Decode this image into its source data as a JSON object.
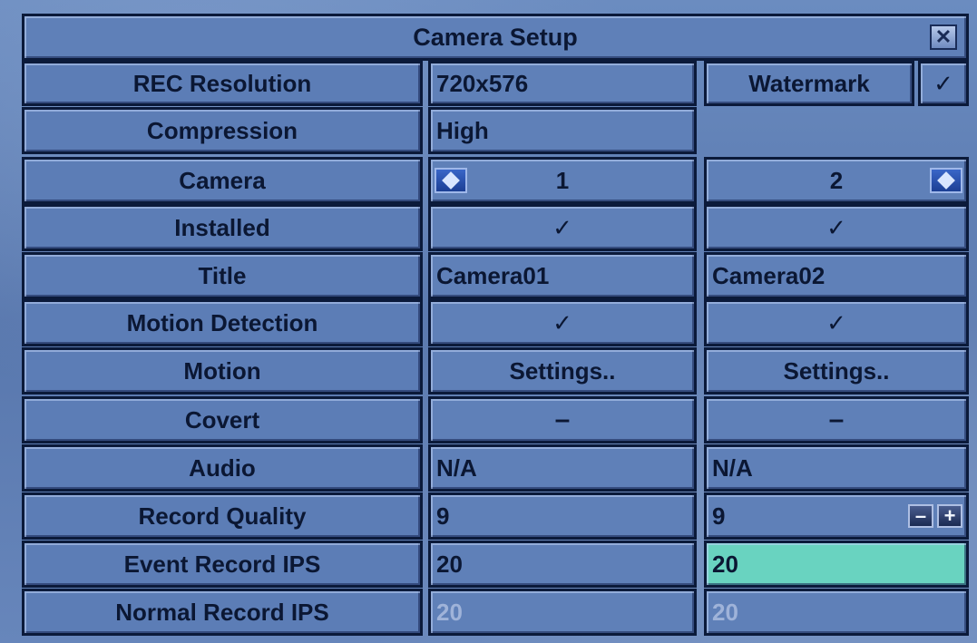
{
  "dialog": {
    "title": "Camera Setup",
    "close_icon_glyph": "✕"
  },
  "rec_resolution": {
    "label": "REC Resolution",
    "value": "720x576"
  },
  "watermark": {
    "label": "Watermark",
    "checked": "✓"
  },
  "compression": {
    "label": "Compression",
    "value": "High"
  },
  "camera": {
    "label": "Camera",
    "cam1": "1",
    "cam2": "2"
  },
  "rows": {
    "installed": {
      "label": "Installed",
      "cam1": "✓",
      "cam2": "✓"
    },
    "title": {
      "label": "Title",
      "cam1": "Camera01",
      "cam2": "Camera02"
    },
    "motion_detection": {
      "label": "Motion Detection",
      "cam1": "✓",
      "cam2": "✓"
    },
    "motion": {
      "label": "Motion",
      "cam1": "Settings..",
      "cam2": "Settings.."
    },
    "covert": {
      "label": "Covert",
      "cam1": "–",
      "cam2": "–"
    },
    "audio": {
      "label": "Audio",
      "cam1": "N/A",
      "cam2": "N/A"
    },
    "record_quality": {
      "label": "Record Quality",
      "cam1": "9",
      "cam2": "9"
    },
    "event_record_ips": {
      "label": "Event Record IPS",
      "cam1": "20",
      "cam2": "20"
    },
    "normal_record_ips": {
      "label": "Normal Record IPS",
      "cam1": "20",
      "cam2": "20"
    }
  },
  "stepper": {
    "minus": "–",
    "plus": "+"
  },
  "colors": {
    "frame": "#0b1a3a",
    "cell": "#5f80b8",
    "selected": "#69d3c0",
    "text": "#0b1733",
    "disabled_text": "#9fb3d9"
  }
}
